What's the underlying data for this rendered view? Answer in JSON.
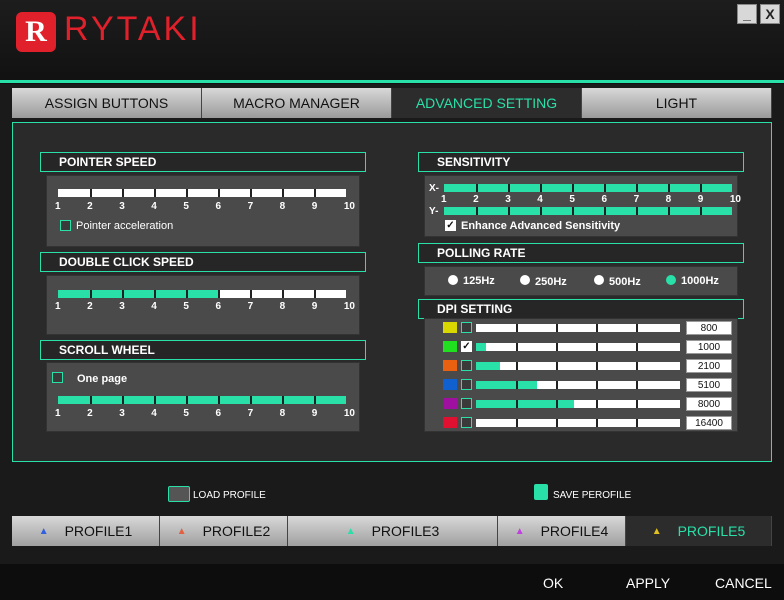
{
  "app": {
    "logo_letter": "R",
    "name": "RYTAKI",
    "minimize_label": "_",
    "close_label": "X"
  },
  "tabs": [
    {
      "label": "ASSIGN BUTTONS",
      "active": false
    },
    {
      "label": "MACRO MANAGER",
      "active": false
    },
    {
      "label": "ADVANCED SETTING",
      "active": true
    },
    {
      "label": "LIGHT",
      "active": false
    }
  ],
  "pointer_speed": {
    "title": "POINTER SPEED",
    "ticks": [
      "1",
      "2",
      "3",
      "4",
      "5",
      "6",
      "7",
      "8",
      "9",
      "10"
    ],
    "value": 0,
    "accel_label": "Pointer acceleration",
    "accel_checked": false
  },
  "double_click": {
    "title": "DOUBLE CLICK SPEED",
    "ticks": [
      "1",
      "2",
      "3",
      "4",
      "5",
      "6",
      "7",
      "8",
      "9",
      "10"
    ],
    "value": 6
  },
  "scroll_wheel": {
    "title": "SCROLL WHEEL",
    "one_page_label": "One page",
    "one_page_checked": false,
    "ticks": [
      "1",
      "2",
      "3",
      "4",
      "5",
      "6",
      "7",
      "8",
      "9",
      "10"
    ],
    "value": 10
  },
  "sensitivity": {
    "title": "SENSITIVITY",
    "x_label": "X-",
    "y_label": "Y-",
    "ticks": [
      "1",
      "2",
      "3",
      "4",
      "5",
      "6",
      "7",
      "8",
      "9",
      "10"
    ],
    "x_value": 10,
    "y_value": 10,
    "enhance_label": "Enhance Advanced Sensitivity",
    "enhance_checked": true
  },
  "polling": {
    "title": "POLLING RATE",
    "options": [
      "125Hz",
      "250Hz",
      "500Hz",
      "1000Hz"
    ],
    "selected": "1000Hz"
  },
  "dpi": {
    "title": "DPI SETTING",
    "levels": [
      {
        "color": "#d8d800",
        "checked": false,
        "value": "800",
        "fill": 0.0
      },
      {
        "color": "#20e020",
        "checked": true,
        "value": "1000",
        "fill": 0.05
      },
      {
        "color": "#e86010",
        "checked": false,
        "value": "2100",
        "fill": 0.12
      },
      {
        "color": "#1060d0",
        "checked": false,
        "value": "5100",
        "fill": 0.3
      },
      {
        "color": "#a010a0",
        "checked": false,
        "value": "8000",
        "fill": 0.48
      },
      {
        "color": "#e01030",
        "checked": false,
        "value": "16400",
        "fill": 0.0
      }
    ]
  },
  "profile_actions": {
    "load": "LOAD PROFILE",
    "save": "SAVE PEROFILE"
  },
  "profiles": [
    {
      "label": "PROFILE1",
      "tri_color": "#3060e0",
      "active": false
    },
    {
      "label": "PROFILE2",
      "tri_color": "#e06040",
      "active": false
    },
    {
      "label": "PROFILE3",
      "tri_color": "#28e0a8",
      "active": false
    },
    {
      "label": "PROFILE4",
      "tri_color": "#c040e0",
      "active": false
    },
    {
      "label": "PROFILE5",
      "tri_color": "#e0c020",
      "active": true
    }
  ],
  "footer": {
    "ok": "OK",
    "apply": "APPLY",
    "cancel": "CANCEL"
  },
  "colors": {
    "accent": "#28e0a8",
    "brand": "#e0202a"
  }
}
